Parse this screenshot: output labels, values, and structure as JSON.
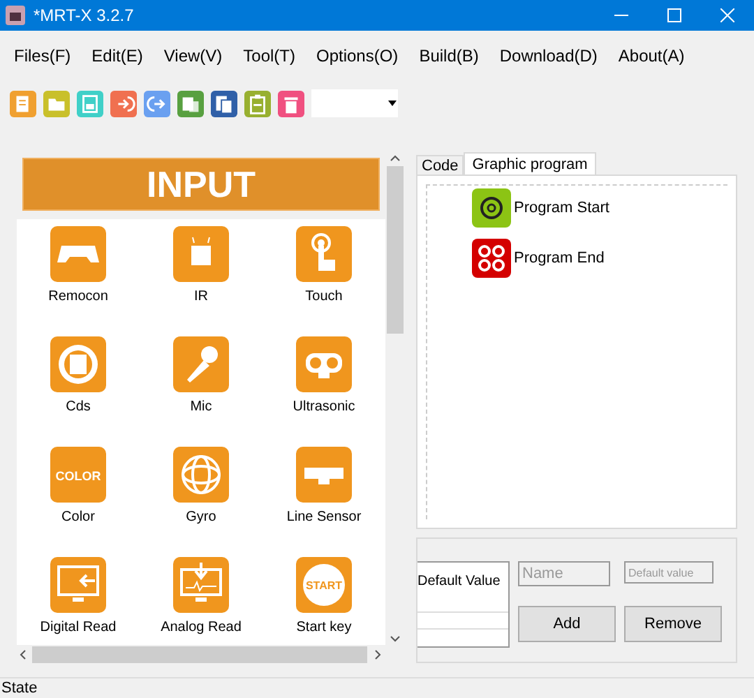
{
  "window": {
    "title": "*MRT-X 3.2.7"
  },
  "menu": [
    "Files(F)",
    "Edit(E)",
    "View(V)",
    "Tool(T)",
    "Options(O)",
    "Build(B)",
    "Download(D)",
    "About(A)"
  ],
  "palette": {
    "title": "INPUT",
    "items": [
      {
        "label": "Remocon"
      },
      {
        "label": "IR"
      },
      {
        "label": "Touch"
      },
      {
        "label": "Cds"
      },
      {
        "label": "Mic"
      },
      {
        "label": "Ultrasonic"
      },
      {
        "label": "Color",
        "icon_text": "COLOR"
      },
      {
        "label": "Gyro"
      },
      {
        "label": "Line Sensor"
      },
      {
        "label": "Digital Read"
      },
      {
        "label": "Analog Read"
      },
      {
        "label": "Start key",
        "icon_text": "START"
      }
    ]
  },
  "tabs": [
    {
      "label": "Code",
      "selected": false
    },
    {
      "label": "Graphic program",
      "selected": true
    }
  ],
  "tree": [
    {
      "label": "Program Start",
      "kind": "start"
    },
    {
      "label": "Program End",
      "kind": "end"
    }
  ],
  "variables": {
    "column": "Default Value",
    "name_placeholder": "Name",
    "value_placeholder": "Default value",
    "buttons": [
      "Add",
      "Remove"
    ]
  },
  "status_bar": "State"
}
